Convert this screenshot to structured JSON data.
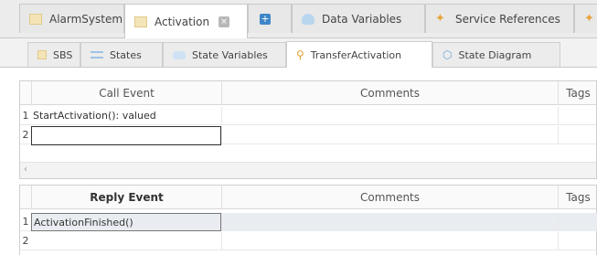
{
  "top_tabs": [
    {
      "label": "AlarmSystem",
      "icon": "file-icon"
    },
    {
      "label": "Activation",
      "icon": "file-icon",
      "close": "×"
    },
    {
      "label": "+",
      "icon": "add-icon"
    },
    {
      "label": "Data Variables",
      "icon": "cloud-icon"
    },
    {
      "label": "Service References",
      "icon": "star-icon"
    }
  ],
  "sub_tabs": [
    {
      "label": "SBS"
    },
    {
      "label": "States"
    },
    {
      "label": "State Variables"
    },
    {
      "label": "TransferActivation"
    },
    {
      "label": "State Diagram"
    }
  ],
  "call_grid": {
    "headers": {
      "event": "Call Event",
      "comments": "Comments",
      "tags": "Tags"
    },
    "rows": [
      {
        "num": "1",
        "event": "StartActivation(): valued",
        "comments": "",
        "tags": ""
      },
      {
        "num": "2",
        "event": "",
        "comments": "",
        "tags": ""
      }
    ],
    "scroll_arrow": "‹"
  },
  "reply_grid": {
    "headers": {
      "event": "Reply Event",
      "comments": "Comments",
      "tags": "Tags"
    },
    "rows": [
      {
        "num": "1",
        "event": "ActivationFinished()",
        "comments": "",
        "tags": ""
      },
      {
        "num": "2",
        "event": "",
        "comments": "",
        "tags": ""
      }
    ]
  },
  "colors": {
    "accent": "#3f86c8",
    "selection_fill": "#e9edf2"
  }
}
